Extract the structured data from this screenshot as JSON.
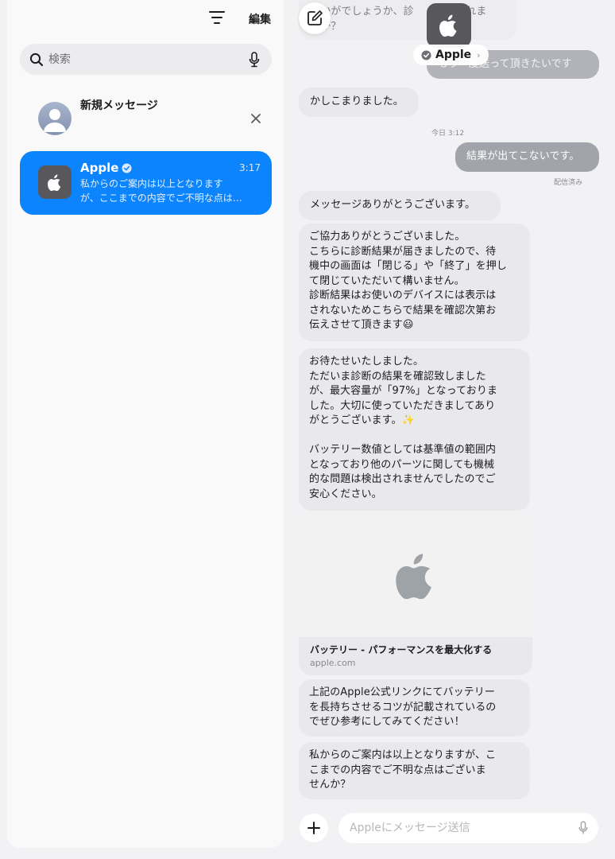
{
  "sidebar": {
    "edit_label": "編集",
    "search": {
      "placeholder": "検索"
    },
    "new_message": {
      "title": "新規メッセージ"
    },
    "conversation": {
      "name": "Apple",
      "time": "3:17",
      "preview_line1": "私からのご案内は以上となります",
      "preview_line2": "が、ここまでの内容でご不明な点は…",
      "selected": true
    }
  },
  "chat": {
    "contact": {
      "name": "Apple",
      "verified": true
    },
    "top_faded": {
      "line1": "いかがでしょうか、診　　　　されま",
      "line2": "すか？"
    },
    "top_out": "もう一度送って頂きたいです",
    "msg_ack": "かしこまりました。",
    "timestamp": "今日 3:12",
    "msg_out_result": "結果が出てこないです。",
    "delivered": "配信済み",
    "msg_thanks": "メッセージありがとうございます。",
    "msg_coop": [
      "ご協力ありがとうございました。",
      "こちらに診断結果が届きましたので、待",
      "機中の画面は「閉じる」や「終了」を押し",
      "て閉じていただいて構いません。",
      "診断結果はお使いのデバイスには表示は",
      "されないためこちらで結果を確認次第お",
      "伝えさせて頂きます😃"
    ],
    "msg_result": [
      "お待たせいたしました。",
      "ただいま診断の結果を確認致しました",
      "が、最大容量が「97%」となっておりま",
      "した。大切に使っていただきましてあり",
      "がとうございます。✨",
      "",
      "バッテリー数値としては基準値の範囲内",
      "となっており他のパーツに関しても機械",
      "的な問題は検出されませんでしたのでご",
      "安心ください。"
    ],
    "link_card": {
      "title": "バッテリー - パフォーマンスを最大化する",
      "domain": "apple.com"
    },
    "msg_link": [
      "上記のApple公式リンクにてバッテリー",
      "を長持ちさせるコツが記載されているの",
      "でぜひ参考にしてみてください！"
    ],
    "msg_final": [
      "私からのご案内は以上となりますが、こ",
      "こまでの内容でご不明な点はございま",
      "せんか？"
    ],
    "input": {
      "placeholder": "Appleにメッセージ送信"
    }
  },
  "colors": {
    "accent": "#0b84fe",
    "incoming_bubble": "#e9e9eb",
    "outgoing_bubble": "#a1a4ab",
    "background": "#f2f2f4"
  },
  "icons": [
    "filter-icon",
    "search-icon",
    "mic-icon",
    "close-icon",
    "apple-logo-icon",
    "verified-badge-icon",
    "compose-icon",
    "chevron-right-icon",
    "plus-icon"
  ]
}
